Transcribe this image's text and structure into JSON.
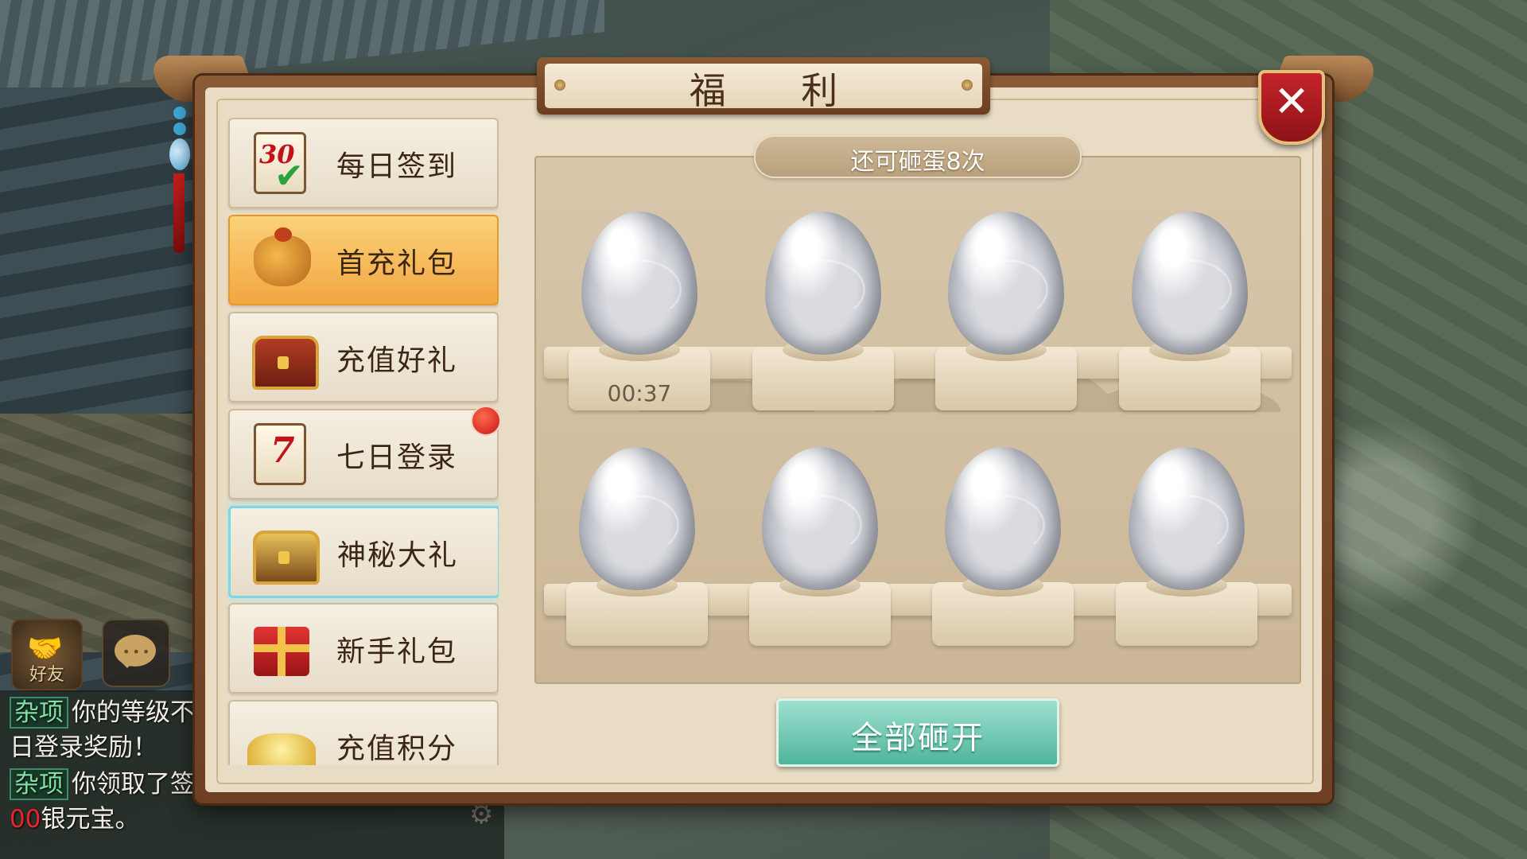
{
  "window": {
    "title": "福 利"
  },
  "close_button": {
    "icon": "close-icon",
    "glyph": "✕"
  },
  "menu": {
    "items": [
      {
        "label": "每日签到",
        "icon": "calendar-30-check-icon",
        "num": "30"
      },
      {
        "label": "首充礼包",
        "icon": "gold-bag-icon",
        "selected": true
      },
      {
        "label": "充值好礼",
        "icon": "treasure-chest-icon"
      },
      {
        "label": "七日登录",
        "icon": "calendar-7-icon",
        "num": "7",
        "notification": true
      },
      {
        "label": "神秘大礼",
        "icon": "open-treasure-chest-icon",
        "active": true
      },
      {
        "label": "新手礼包",
        "icon": "gift-box-icon"
      },
      {
        "label": "充值积分",
        "icon": "gold-pile-icon"
      }
    ]
  },
  "egg_panel": {
    "remaining_text": "还可砸蛋8次",
    "eggs": [
      {
        "timer": "00:37"
      },
      {
        "timer": ""
      },
      {
        "timer": ""
      },
      {
        "timer": ""
      },
      {
        "timer": ""
      },
      {
        "timer": ""
      },
      {
        "timer": ""
      },
      {
        "timer": ""
      }
    ],
    "smash_all_label": "全部砸开"
  },
  "chat": {
    "friend_label": "好友",
    "lines": [
      {
        "tag": "杂项",
        "text": "你的等级不"
      },
      {
        "tag": "",
        "text": "日登录奖励！"
      },
      {
        "tag": "杂项",
        "text": "你领取了签"
      },
      {
        "red": "00",
        "text": "银元宝。"
      }
    ]
  },
  "colors": {
    "selected_menu": "#f2a640",
    "active_menu_glow": "#7fd6e4",
    "close_red": "#c4242a",
    "smash_button": "#4fb59c"
  }
}
